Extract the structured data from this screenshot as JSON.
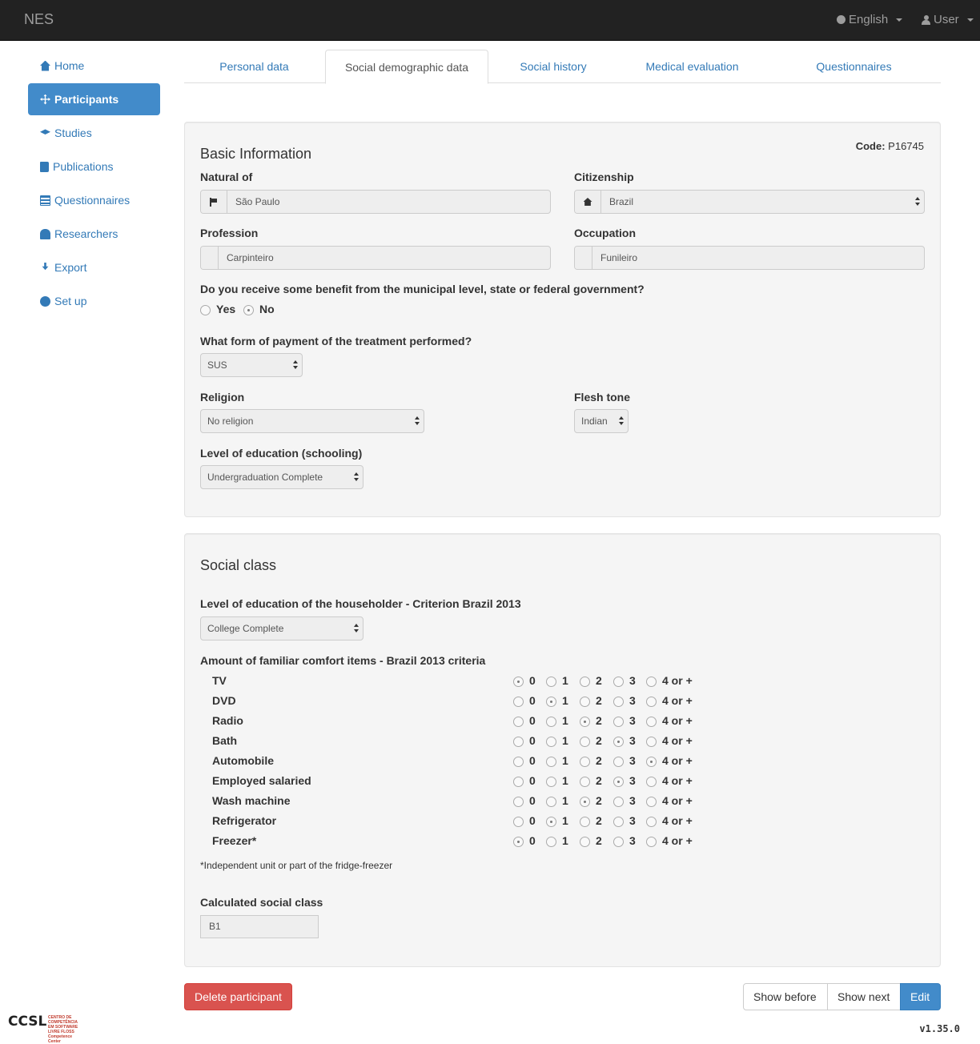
{
  "navbar": {
    "brand": "NES",
    "language": "English",
    "user": "User",
    "language_icon": "globe-icon",
    "user_icon": "user-icon"
  },
  "sidebar": {
    "items": [
      {
        "label": "Home",
        "icon": "home-icon"
      },
      {
        "label": "Participants",
        "icon": "move-icon",
        "active": true
      },
      {
        "label": "Studies",
        "icon": "graduation-cap-icon"
      },
      {
        "label": "Publications",
        "icon": "book-icon"
      },
      {
        "label": "Questionnaires",
        "icon": "list-icon"
      },
      {
        "label": "Researchers",
        "icon": "user-icon"
      },
      {
        "label": "Export",
        "icon": "export-icon"
      },
      {
        "label": "Set up",
        "icon": "cog-icon"
      }
    ]
  },
  "tabs": [
    "Personal data",
    "Social demographic data",
    "Social history",
    "Medical evaluation",
    "Questionnaires"
  ],
  "basic": {
    "title": "Basic Information",
    "code_label": "Code:",
    "code_value": "P16745",
    "natural_label": "Natural of",
    "natural_value": "São Paulo",
    "citizenship_label": "Citizenship",
    "citizenship_value": "Brazil",
    "profession_label": "Profession",
    "profession_value": "Carpinteiro",
    "occupation_label": "Occupation",
    "occupation_value": "Funileiro",
    "benefit_question": "Do you receive some benefit from the municipal level, state or federal government?",
    "yes": "Yes",
    "no": "No",
    "benefit_selected": "No",
    "payment_label": "What form of payment of the treatment performed?",
    "payment_value": "SUS",
    "religion_label": "Religion",
    "religion_value": "No religion",
    "flesh_label": "Flesh tone",
    "flesh_value": "Indian",
    "education_label": "Level of education (schooling)",
    "education_value": "Undergraduation Complete"
  },
  "social": {
    "title": "Social class",
    "householder_label": "Level of education of the householder - Criterion Brazil 2013",
    "householder_value": "College Complete",
    "comfort_label": "Amount of familiar comfort items - Brazil 2013 criteria",
    "options": [
      "0",
      "1",
      "2",
      "3",
      "4 or +"
    ],
    "items": [
      {
        "label": "TV",
        "selected": 0
      },
      {
        "label": "DVD",
        "selected": 1
      },
      {
        "label": "Radio",
        "selected": 2
      },
      {
        "label": "Bath",
        "selected": 3
      },
      {
        "label": "Automobile",
        "selected": 4
      },
      {
        "label": "Employed salaried",
        "selected": 3
      },
      {
        "label": "Wash machine",
        "selected": 2
      },
      {
        "label": "Refrigerator",
        "selected": 1
      },
      {
        "label": "Freezer*",
        "selected": 0
      }
    ],
    "footnote": "*Independent unit or part of the fridge-freezer",
    "calc_label": "Calculated social class",
    "calc_value": "B1"
  },
  "buttons": {
    "delete": "Delete participant",
    "show_before": "Show before",
    "show_next": "Show next",
    "edit": "Edit"
  },
  "footer": {
    "logo": "CCSL",
    "logo_subtitle": "CENTRO DE COMPETÊNCIA EM SOFTWARE LIVRE FLOSS Competence Center",
    "version": "v1.35.0"
  }
}
